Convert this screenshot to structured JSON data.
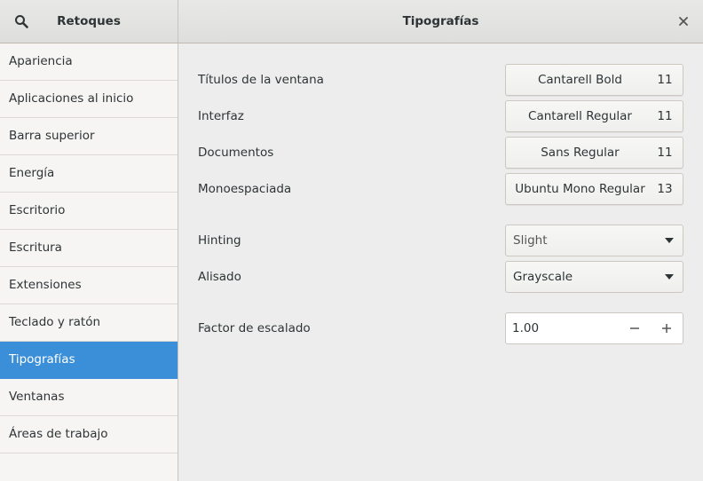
{
  "header": {
    "app_title": "Retoques",
    "page_title": "Tipografías"
  },
  "sidebar": {
    "items": [
      {
        "label": "Apariencia",
        "active": false
      },
      {
        "label": "Aplicaciones al inicio",
        "active": false
      },
      {
        "label": "Barra superior",
        "active": false
      },
      {
        "label": "Energía",
        "active": false
      },
      {
        "label": "Escritorio",
        "active": false
      },
      {
        "label": "Escritura",
        "active": false
      },
      {
        "label": "Extensiones",
        "active": false
      },
      {
        "label": "Teclado y ratón",
        "active": false
      },
      {
        "label": "Tipografías",
        "active": true
      },
      {
        "label": "Ventanas",
        "active": false
      },
      {
        "label": "Áreas de trabajo",
        "active": false
      }
    ]
  },
  "fonts": [
    {
      "label": "Títulos de la ventana",
      "font": "Cantarell Bold",
      "size": "11"
    },
    {
      "label": "Interfaz",
      "font": "Cantarell Regular",
      "size": "11"
    },
    {
      "label": "Documentos",
      "font": "Sans Regular",
      "size": "11"
    },
    {
      "label": "Monoespaciada",
      "font": "Ubuntu Mono Regular",
      "size": "13"
    }
  ],
  "hinting": {
    "label": "Hinting",
    "value": "Slight"
  },
  "antialiasing": {
    "label": "Alisado",
    "value": "Grayscale"
  },
  "scaling": {
    "label": "Factor de escalado",
    "value": "1.00"
  },
  "colors": {
    "accent": "#3a8fd8",
    "text": "#2e3436",
    "background": "#ededed"
  },
  "icons": {
    "search": "search-icon",
    "close": "close-icon",
    "dropdown": "pan-down-icon",
    "minus": "minus-icon",
    "plus": "plus-icon"
  }
}
